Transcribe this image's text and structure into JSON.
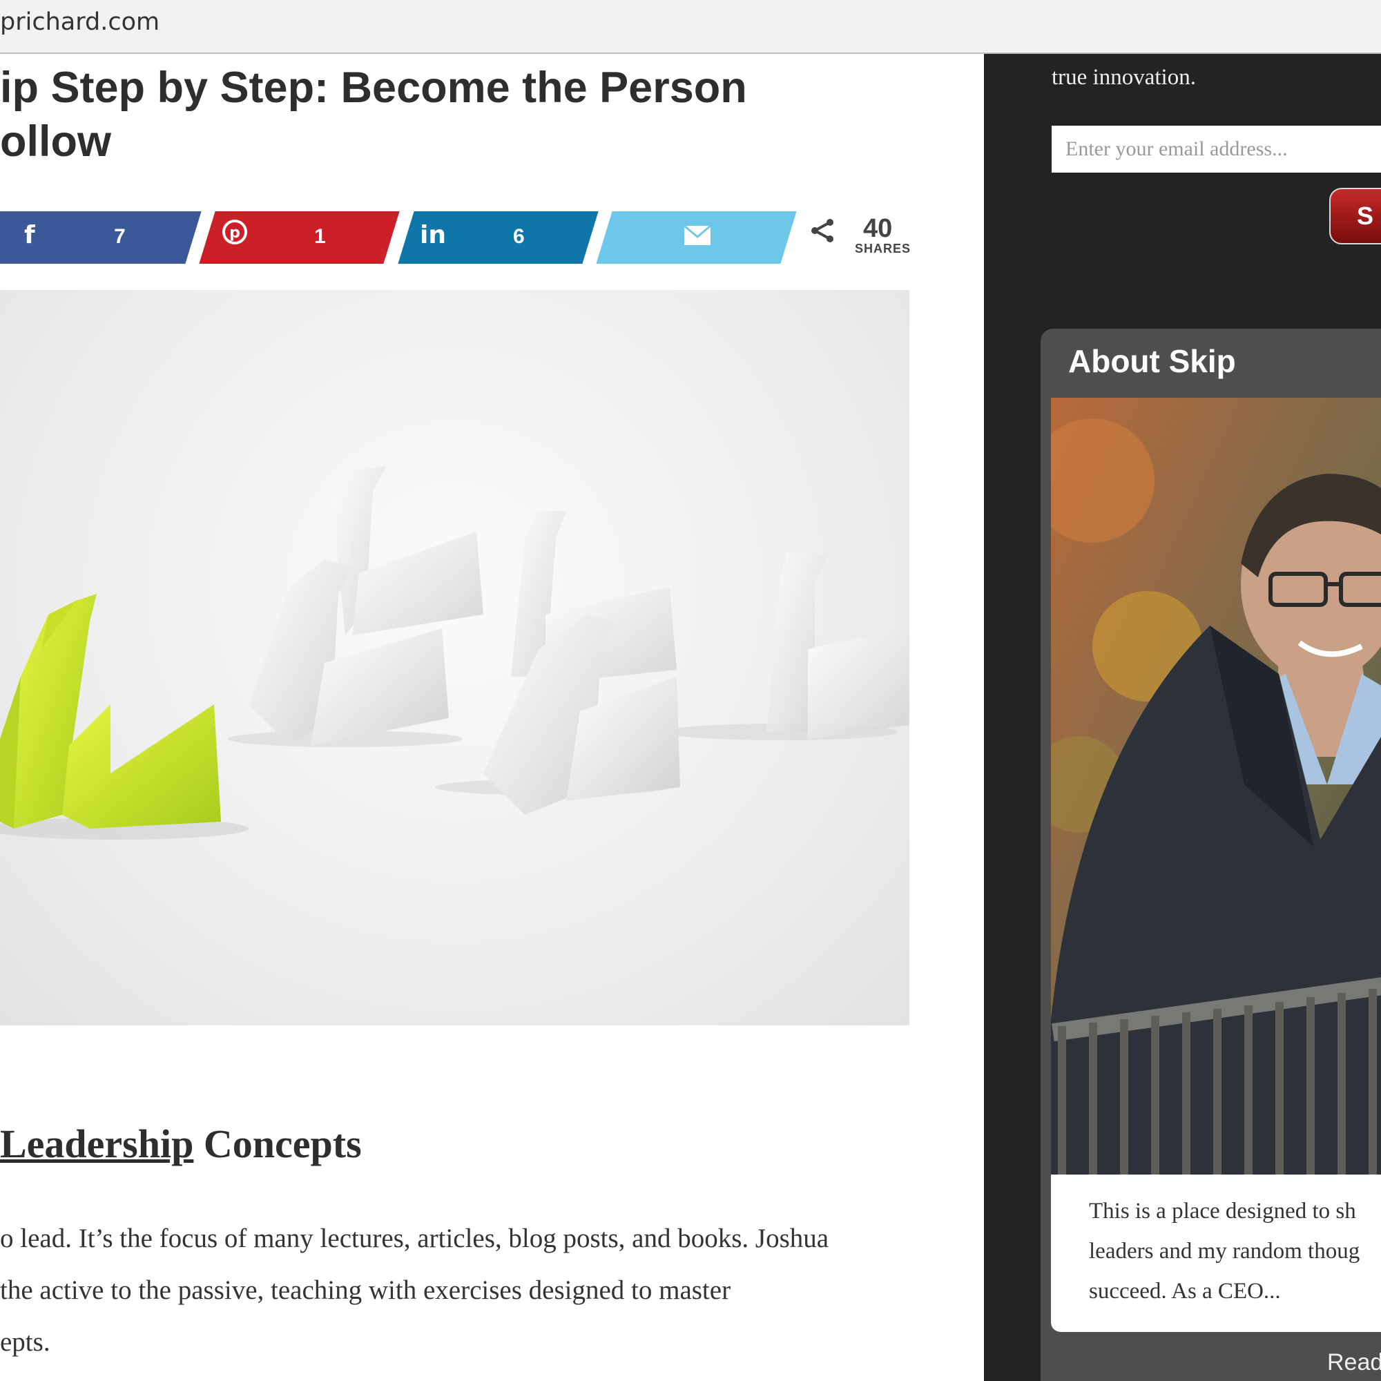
{
  "browser": {
    "url": "prichard.com"
  },
  "article": {
    "title_line1": "ip Step by Step: Become the Person",
    "title_line2": "ollow",
    "share": {
      "facebook_count": "7",
      "pinterest_count": "1",
      "linkedin_count": "6",
      "total_count": "40",
      "total_label": "SHARES",
      "colors": {
        "facebook": "#3b5998",
        "pinterest": "#cb2027",
        "linkedin": "#0e76a8",
        "email": "#6cc7e8"
      }
    },
    "hero_image": "origami-swans-one-green-leading-white",
    "section_heading_link": "Leadership",
    "section_heading_rest": " Concepts",
    "paragraph_lines": [
      "o lead. It’s the focus of many lectures, articles, blog posts, and books. Joshua",
      "the active to the passive, teaching with exercises designed to master",
      "epts."
    ]
  },
  "sidebar": {
    "intro_text": "true innovation.",
    "email_placeholder": "Enter your email address...",
    "subscribe_label": "S",
    "about_title": "About Skip",
    "about_photo": "portrait-man-in-suit-leaning-on-railing-autumn",
    "about_lines": [
      "This is a place designed to sh",
      "leaders and my random thoug",
      "succeed. As a CEO..."
    ],
    "read_more_label": "Read"
  }
}
